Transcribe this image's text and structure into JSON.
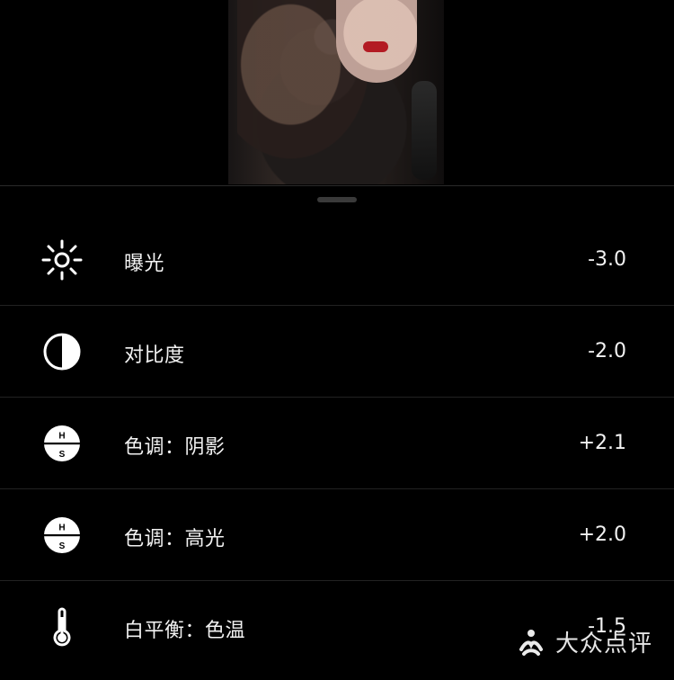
{
  "adjustments": [
    {
      "name": "曝光",
      "value": "-3.0",
      "icon": "sun-icon"
    },
    {
      "name": "对比度",
      "value": "-2.0",
      "icon": "contrast-icon"
    },
    {
      "name": "色调：阴影",
      "value": "+2.1",
      "icon": "hs-icon"
    },
    {
      "name": "色调：高光",
      "value": "+2.0",
      "icon": "hs-icon"
    },
    {
      "name": "白平衡：色温",
      "value": "-1.5",
      "icon": "thermometer-icon"
    }
  ],
  "watermark": {
    "brand": "大众点评",
    "icon": "dianping-logo-icon"
  },
  "colors": {
    "background": "#000000",
    "text": "#F2F2F2",
    "divider": "#222222",
    "handle": "#3A3A3A"
  }
}
